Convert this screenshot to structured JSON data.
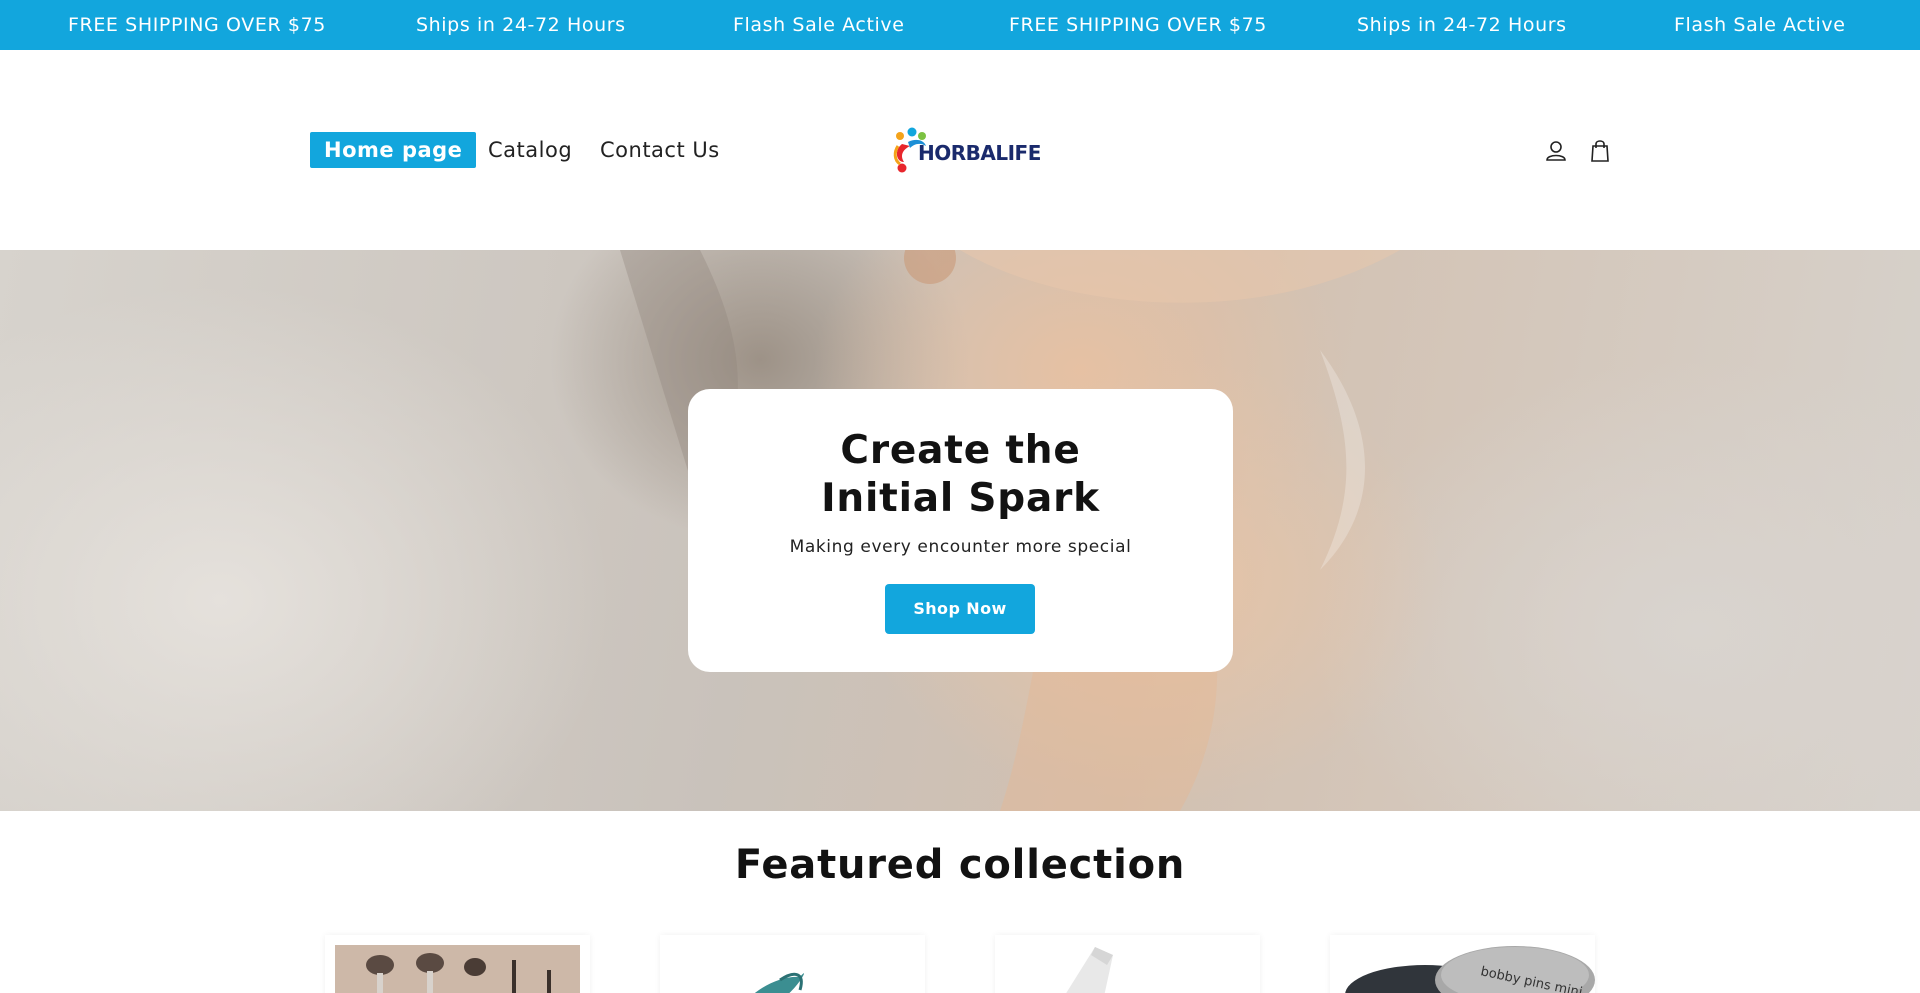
{
  "announcement": {
    "items": [
      "FREE SHIPPING OVER $75",
      "Ships in 24-72 Hours",
      "Flash Sale Active",
      "FREE SHIPPING OVER $75",
      "Ships in 24-72 Hours",
      "Flash Sale Active"
    ]
  },
  "colors": {
    "accent": "#12a6dd",
    "text": "#121212",
    "logo_navy": "#1a2a6c"
  },
  "header": {
    "nav": [
      {
        "label": "Home page",
        "active": true
      },
      {
        "label": "Catalog",
        "active": false
      },
      {
        "label": "Contact Us",
        "active": false
      }
    ],
    "logo_text": "HORBALIFE",
    "icons": [
      "account-icon",
      "cart-icon"
    ]
  },
  "hero": {
    "title": "Create the Initial Spark",
    "subtitle": "Making every encounter more special",
    "button_label": "Shop Now"
  },
  "featured": {
    "title": "Featured collection",
    "products": [
      {
        "image": "makeup-brushes"
      },
      {
        "image": "teal-hair-clip"
      },
      {
        "image": "white-bottle"
      },
      {
        "image": "bobby-pins-tin",
        "image_text": "bobby pins mini"
      }
    ]
  }
}
